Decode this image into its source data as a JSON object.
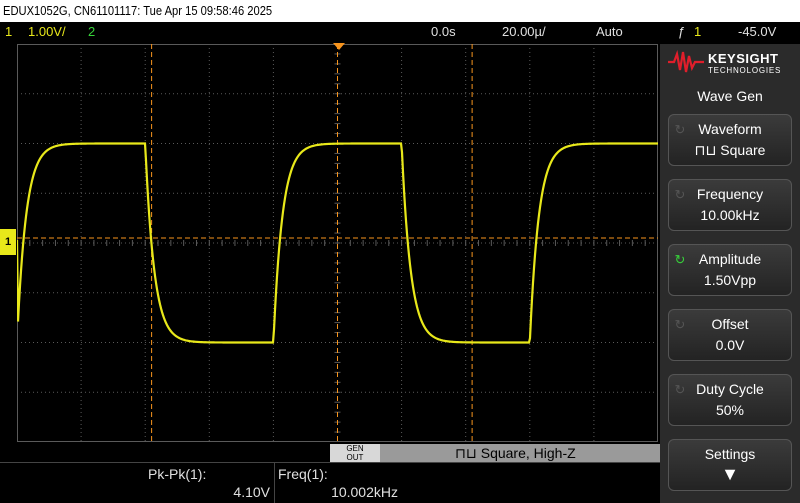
{
  "title_bar": "EDUX1052G, CN61101117: Tue Apr 15 09:58:46 2025",
  "status": {
    "ch1_num": "1",
    "ch1_scale": "1.00V/",
    "ch2_num": "2",
    "time_offset": "0.0s",
    "time_scale": "20.00µ/",
    "trigger_mode": "Auto",
    "trigger_icon": "ƒ",
    "trigger_ch": "1",
    "trigger_level": "-45.0V"
  },
  "ch1_marker": "1",
  "logo": {
    "brand": "KEYSIGHT",
    "sub": "TECHNOLOGIES"
  },
  "menu": {
    "title": "Wave Gen",
    "keys": [
      {
        "top": "Waveform",
        "bottom": "⊓⊔ Square"
      },
      {
        "top": "Frequency",
        "bottom": "10.00kHz"
      },
      {
        "top": "Amplitude",
        "bottom": "1.50Vpp"
      },
      {
        "top": "Offset",
        "bottom": "0.0V"
      },
      {
        "top": "Duty Cycle",
        "bottom": "50%"
      },
      {
        "top": "Settings",
        "bottom": "▼"
      }
    ]
  },
  "gen": {
    "button": "GEN\nOUT",
    "button_top": "GEN",
    "button_bot": "OUT",
    "status": "⊓⊔ Square, High-Z"
  },
  "measurements": [
    {
      "label": "Pk-Pk(1):",
      "value": "4.10V"
    },
    {
      "label": "Freq(1):",
      "value": "10.002kHz"
    }
  ],
  "colors": {
    "ch1": "#e8e81a",
    "ch2": "#37d23a",
    "cursor": "#f7941d",
    "grid": "#5a5a5a"
  },
  "trace": {
    "period_divs": 4.0,
    "high_div": -2.0,
    "low_div": 2.0,
    "first_rise_div": 0.0
  }
}
